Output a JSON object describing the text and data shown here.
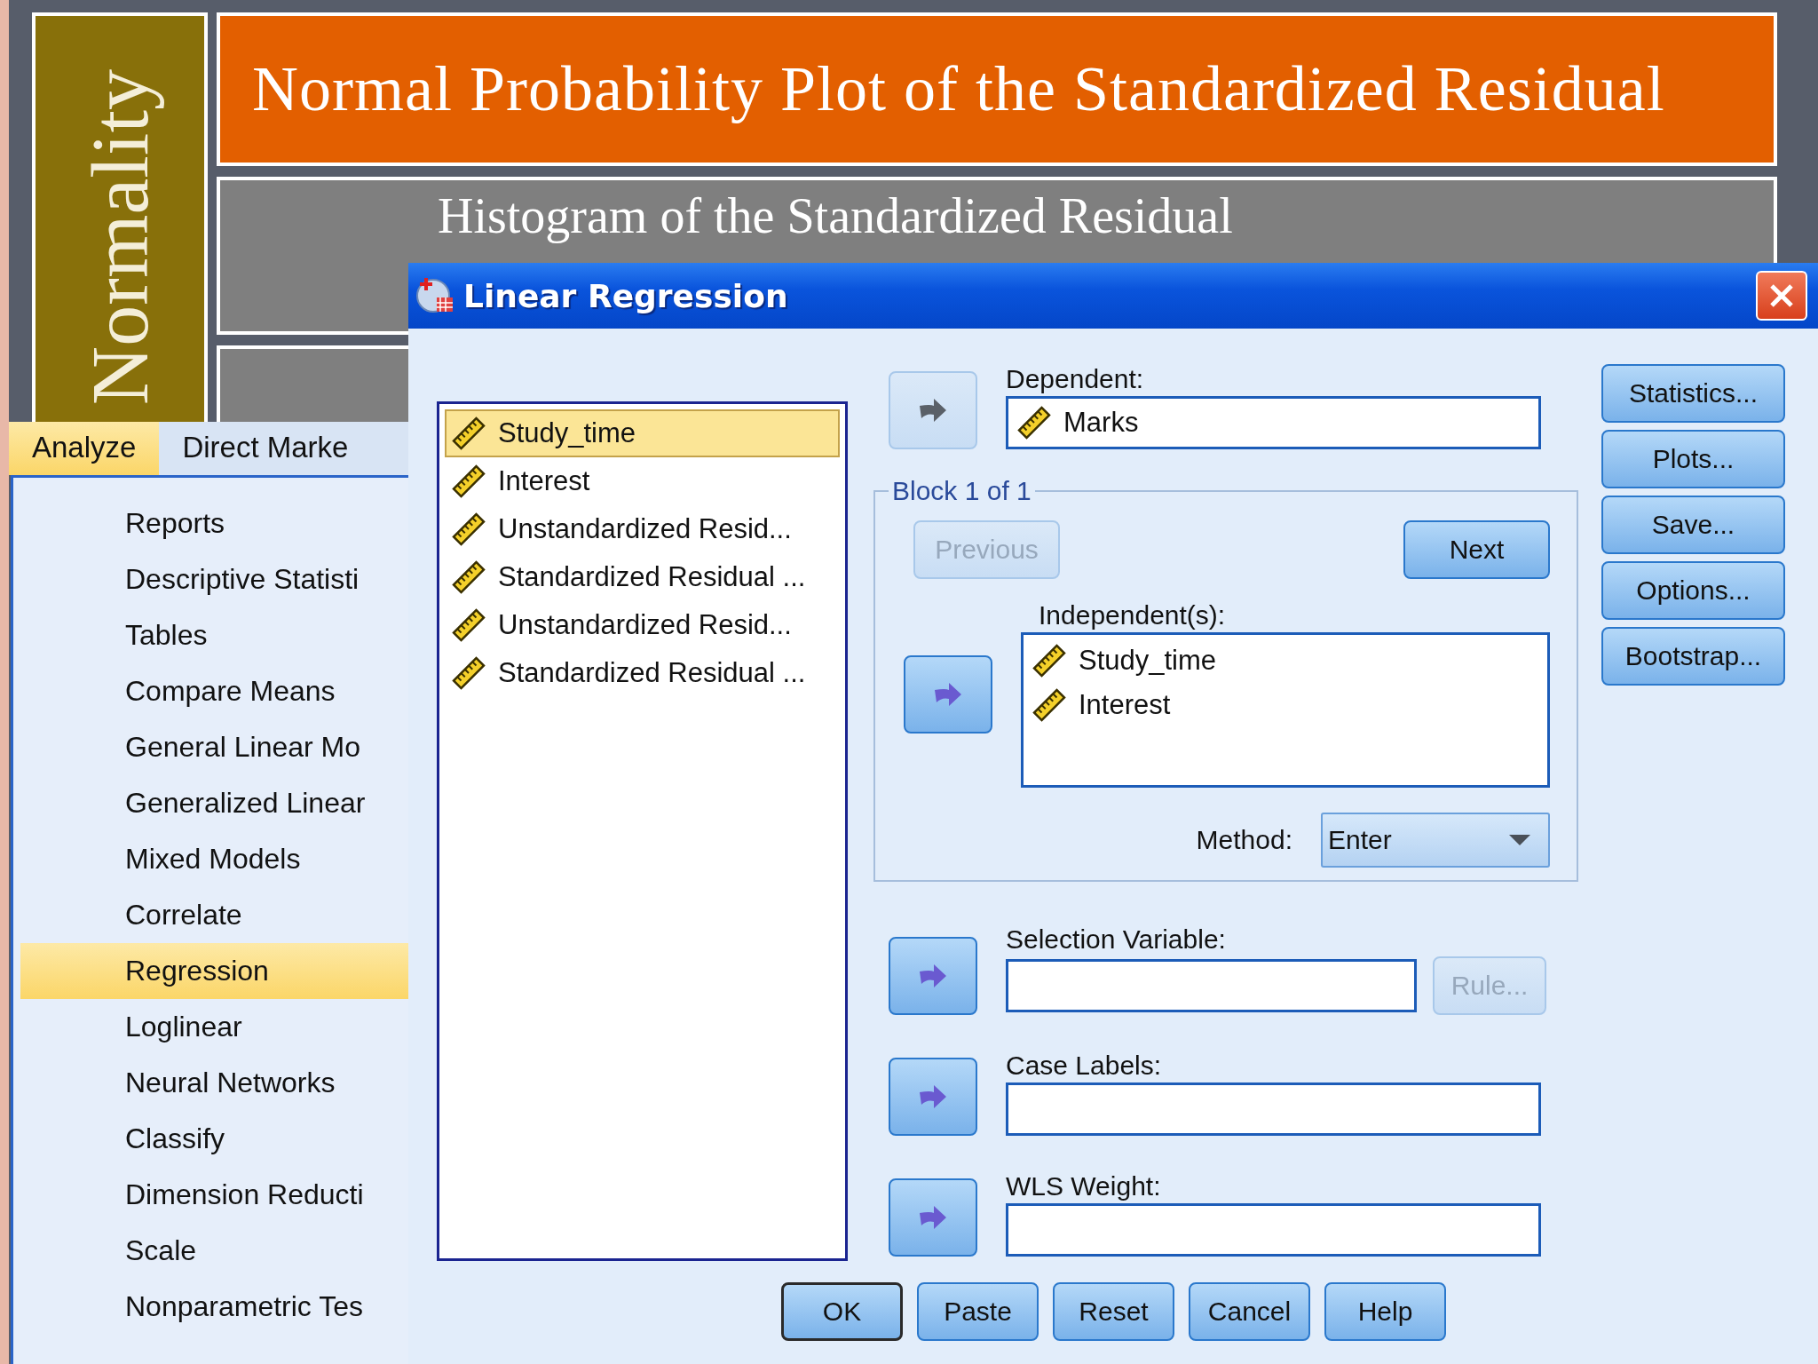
{
  "slide": {
    "side_title": "Normality",
    "title": "Normal Probability Plot of the Standardized Residual",
    "subtitle": "Histogram of the Standardized Residual"
  },
  "menu_bar": [
    {
      "label": "Analyze",
      "selected": true
    },
    {
      "label": "Direct Marke",
      "selected": false
    }
  ],
  "menu": [
    {
      "label": "Reports",
      "selected": false
    },
    {
      "label": "Descriptive Statisti",
      "selected": false
    },
    {
      "label": "Tables",
      "selected": false
    },
    {
      "label": "Compare Means",
      "selected": false
    },
    {
      "label": "General Linear Mo",
      "selected": false
    },
    {
      "label": "Generalized Linear",
      "selected": false
    },
    {
      "label": "Mixed Models",
      "selected": false
    },
    {
      "label": "Correlate",
      "selected": false
    },
    {
      "label": "Regression",
      "selected": true
    },
    {
      "label": "Loglinear",
      "selected": false
    },
    {
      "label": "Neural Networks",
      "selected": false
    },
    {
      "label": "Classify",
      "selected": false
    },
    {
      "label": "Dimension Reducti",
      "selected": false
    },
    {
      "label": "Scale",
      "selected": false
    },
    {
      "label": "Nonparametric Tes",
      "selected": false
    }
  ],
  "dialog": {
    "title": "Linear Regression",
    "variables": [
      {
        "name": "Study_time",
        "selected": true
      },
      {
        "name": "Interest",
        "selected": false
      },
      {
        "name": "Unstandardized Resid...",
        "selected": false
      },
      {
        "name": "Standardized Residual ...",
        "selected": false
      },
      {
        "name": "Unstandardized Resid...",
        "selected": false
      },
      {
        "name": "Standardized Residual ...",
        "selected": false
      }
    ],
    "dependent": {
      "label": "Dependent:",
      "value": "Marks",
      "arrow_disabled": true
    },
    "block": {
      "label": "Block 1 of 1",
      "previous": {
        "label": "Previous",
        "disabled": true
      },
      "next": {
        "label": "Next",
        "disabled": false
      },
      "independents_label": "Independent(s):",
      "independents": [
        "Study_time",
        "Interest"
      ],
      "arrow_disabled": false,
      "method_label": "Method:",
      "method": "Enter"
    },
    "selection_variable": {
      "label": "Selection Variable:",
      "arrow_disabled": false,
      "rule": {
        "label": "Rule...",
        "disabled": true
      }
    },
    "case_labels": {
      "label": "Case Labels:",
      "arrow_disabled": false
    },
    "wls_weight": {
      "label": "WLS Weight:",
      "arrow_disabled": false
    },
    "side_buttons": [
      "Statistics...",
      "Plots...",
      "Save...",
      "Options...",
      "Bootstrap..."
    ],
    "buttons": [
      {
        "label": "OK",
        "default": true
      },
      {
        "label": "Paste",
        "default": false
      },
      {
        "label": "Reset",
        "default": false
      },
      {
        "label": "Cancel",
        "default": false
      },
      {
        "label": "Help",
        "default": false
      }
    ]
  }
}
